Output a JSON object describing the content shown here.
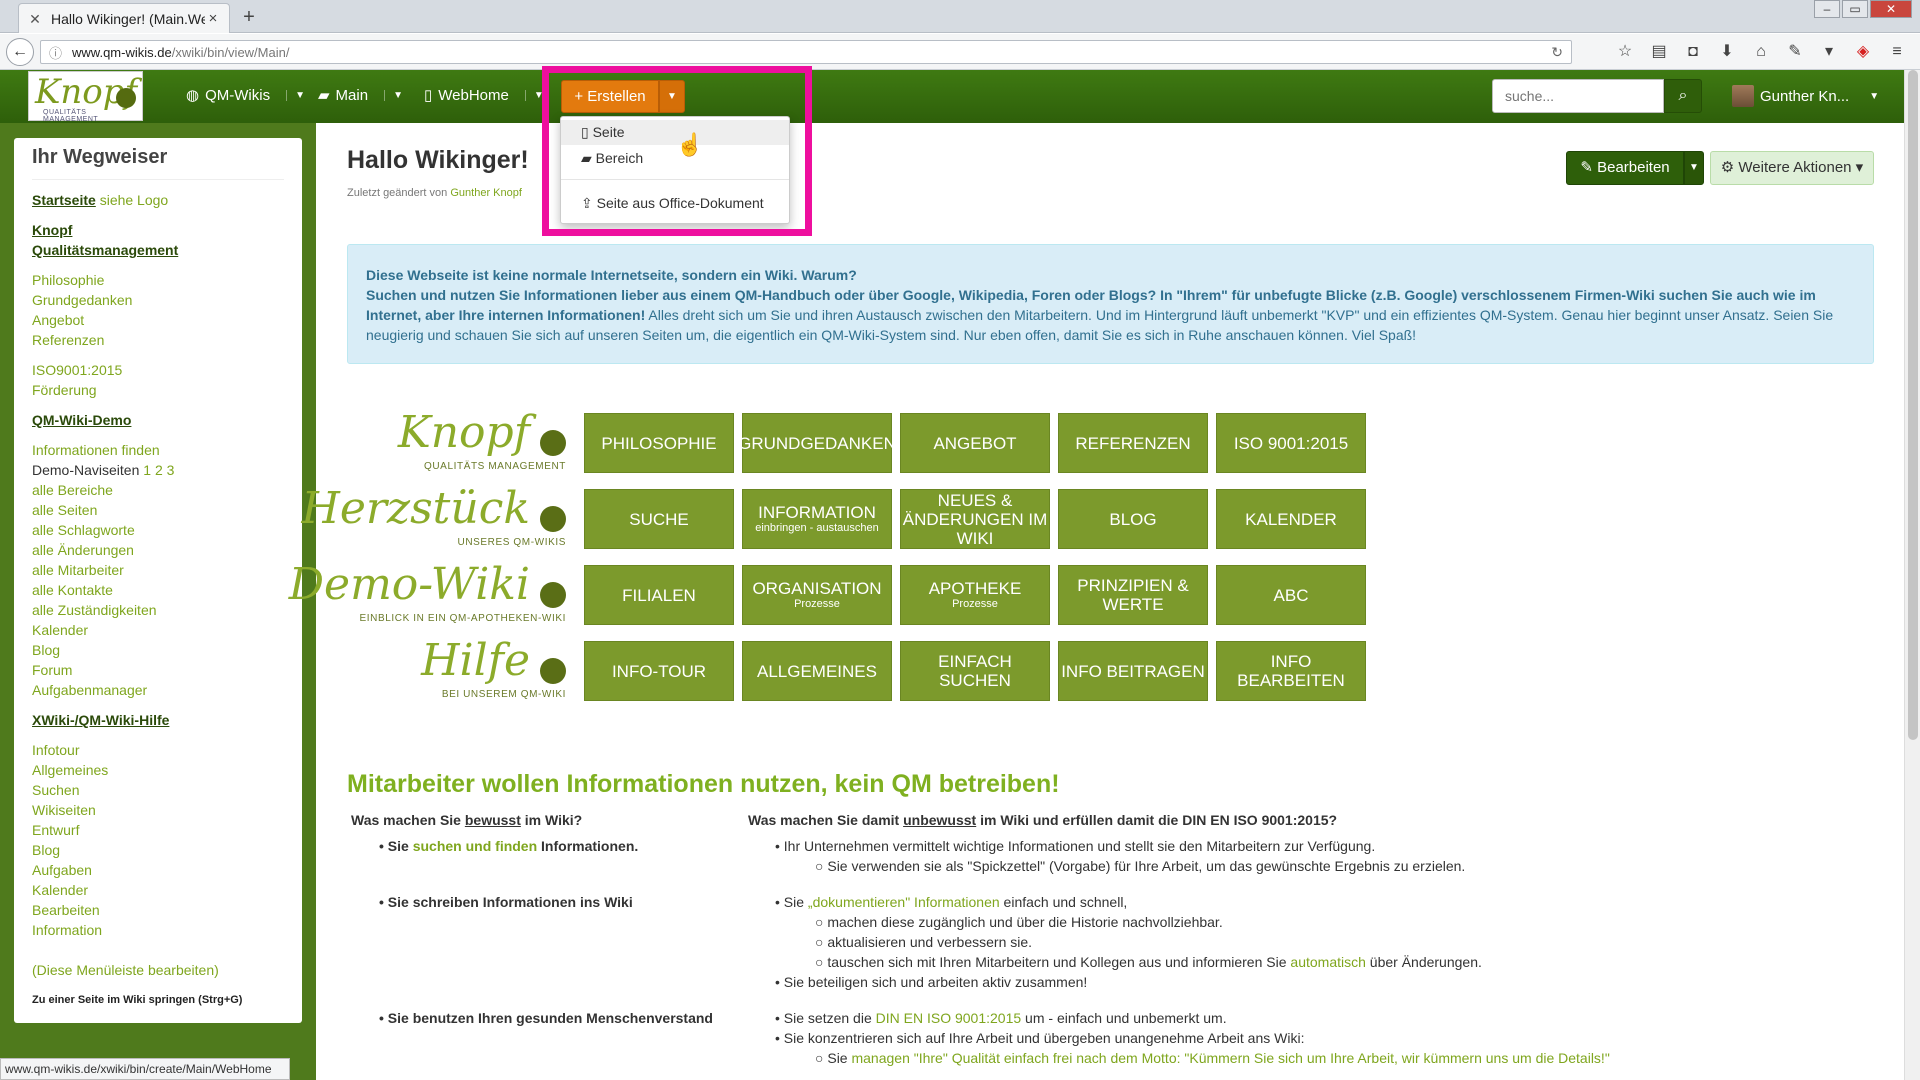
{
  "browser": {
    "tab_title": "Hallo Wikinger! (Main.Web...",
    "url_domain": "www.qm-wikis.de",
    "url_path": "/xwiki/bin/view/Main/",
    "status_url": "www.qm-wikis.de/xwiki/bin/create/Main/WebHome"
  },
  "topnav": {
    "logo_text": "Knopf",
    "logo_sub": "QUALITÄTS MANAGEMENT",
    "items": [
      {
        "icon": "globe-icon",
        "label": "QM-Wikis"
      },
      {
        "icon": "folder-icon",
        "label": "Main"
      },
      {
        "icon": "file-icon",
        "label": "WebHome"
      }
    ],
    "create_label": "Erstellen",
    "search_placeholder": "suche...",
    "user_name": "Gunther Kn..."
  },
  "create_menu": {
    "items": [
      "Seite",
      "Bereich",
      "Seite aus Office-Dokument"
    ]
  },
  "sidebar": {
    "title": "Ihr Wegweiser",
    "start": "Startseite",
    "start_note": "siehe Logo",
    "sec1": "Knopf",
    "sec1b": "Qualitätsmanagement",
    "links1": [
      "Philosophie",
      "Grundgedanken",
      "Angebot",
      "Referenzen"
    ],
    "links2": [
      "ISO9001:2015",
      "Förderung"
    ],
    "sec2": "QM-Wiki-Demo",
    "links3a": "Informationen finden",
    "demo_label": "Demo-Naviseiten",
    "demo_nums": "1 2 3",
    "links3": [
      "alle Bereiche",
      "alle Seiten",
      "alle Schlagworte",
      "alle Änderungen",
      "alle Mitarbeiter",
      "alle Kontakte",
      "alle Zuständigkeiten",
      "Kalender",
      "Blog",
      "Forum",
      "Aufgabenmanager"
    ],
    "sec3": "XWiki-/QM-Wiki-Hilfe",
    "links4": [
      "Infotour",
      "Allgemeines",
      "Suchen",
      "Wikiseiten",
      "Entwurf",
      "Blog",
      "Aufgaben",
      "Kalender",
      "Bearbeiten",
      "Information"
    ],
    "edit_link": "(Diese Menüleiste bearbeiten)",
    "jump": "Zu einer Seite im Wiki springen (Strg+G)"
  },
  "page": {
    "title": "Hallo Wikinger!",
    "last_mod_prefix": "Zuletzt geändert von",
    "last_mod_user": "Gunther Knopf",
    "edit_label": "Bearbeiten",
    "more_label": "Weitere Aktionen",
    "info_l1": "Diese Webseite ist keine normale Internetseite, sondern ein Wiki. Warum?",
    "info_l2b": "Suchen und nutzen Sie Informationen lieber aus einem QM-Handbuch oder über Google, Wikipedia, Foren oder Blogs? In \"Ihrem\" für unbefugte Blicke (z.B. Google) verschlossenem Firmen-Wiki suchen Sie auch wie im Internet, aber Ihre internen Informationen!",
    "info_l2": " Alles dreht sich um Sie und ihren Austausch zwischen den Mitarbeitern. Und im Hintergrund läuft unbemerkt \"KVP\" und ein effizientes QM-System. Genau hier beginnt unser Ansatz. Seien Sie neugierig und schauen Sie sich auf unseren Seiten um, die eigentlich ein QM-Wiki-System sind. Nur eben offen, damit Sie es sich in Ruhe anschauen können. Viel Spaß!"
  },
  "logos": [
    {
      "word": "Knopf",
      "sub": "QUALITÄTS MANAGEMENT"
    },
    {
      "word": "Herzstück",
      "sub": "UNSERES QM-WIKIS"
    },
    {
      "word": "Demo-Wiki",
      "sub": "EINBLICK IN EIN QM-APOTHEKEN-WIKI"
    },
    {
      "word": "Hilfe",
      "sub": "BEI UNSEREM QM-WIKI"
    }
  ],
  "tiles": [
    [
      {
        "t": "Philosophie"
      },
      {
        "t": "Grundgedanken"
      },
      {
        "t": "Angebot"
      },
      {
        "t": "Referenzen"
      },
      {
        "t": "ISO 9001:2015"
      }
    ],
    [
      {
        "t": "Suche"
      },
      {
        "t": "Information",
        "s": "einbringen - austauschen"
      },
      {
        "t": "Neues & Änderungen im Wiki"
      },
      {
        "t": "Blog"
      },
      {
        "t": "Kalender"
      }
    ],
    [
      {
        "t": "Filialen"
      },
      {
        "t": "Organisation",
        "s": "Prozesse"
      },
      {
        "t": "Apotheke",
        "s": "Prozesse"
      },
      {
        "t": "Prinzipien & Werte"
      },
      {
        "t": "ABC"
      }
    ],
    [
      {
        "t": "Info-Tour"
      },
      {
        "t": "Allgemeines"
      },
      {
        "t": "Einfach suchen"
      },
      {
        "t": "Info beitragen"
      },
      {
        "t": "Info bearbeiten"
      }
    ]
  ],
  "section": {
    "heading": "Mitarbeiter wollen Informationen nutzen, kein QM betreiben!",
    "col1_a": "Was machen Sie ",
    "col1_u": "bewusst",
    "col1_b": " im Wiki?",
    "col2_a": "Was machen Sie damit ",
    "col2_u": "unbewusst",
    "col2_b": " im Wiki und erfüllen damit die DIN EN ISO 9001:2015?",
    "l1_a": "Sie ",
    "l1_g": "suchen und finden",
    "l1_b": " Informationen.",
    "l2": "Sie schreiben Informationen ins Wiki",
    "l3": "Sie benutzen Ihren gesunden Menschenverstand",
    "r1": "Ihr Unternehmen vermittelt wichtige Informationen und stellt sie den Mitarbeitern zur Verfügung.",
    "r1s": "Sie verwenden sie als \"Spickzettel\" (Vorgabe) für Ihre Arbeit, um das gewünschte Ergebnis zu erzielen.",
    "r2_a": "Sie ",
    "r2_g": "„dokumentieren\" Informationen",
    "r2_b": " einfach und schnell,",
    "r2s1": "machen diese zugänglich und über die Historie nachvollziehbar.",
    "r2s2": "aktualisieren und verbessern sie.",
    "r2s3_a": "tauschen sich mit Ihren Mitarbeitern und Kollegen aus und informieren Sie ",
    "r2s3_g": "automatisch",
    "r2s3_b": " über Änderungen.",
    "r3": "Sie beteiligen sich und arbeiten aktiv zusammen!",
    "r4_a": "Sie setzen die ",
    "r4_g": "DIN EN ISO 9001:2015",
    "r4_b": " um - einfach und unbemerkt um.",
    "r5": "Sie konzentrieren sich auf Ihre Arbeit und übergeben unangenehme Arbeit ans Wiki:",
    "r5s_a": "Sie ",
    "r5s_g": "managen \"Ihre\" Qualität einfach frei nach dem Motto: \"Kümmern Sie sich um Ihre Arbeit, wir kümmern uns um die Details!\""
  }
}
